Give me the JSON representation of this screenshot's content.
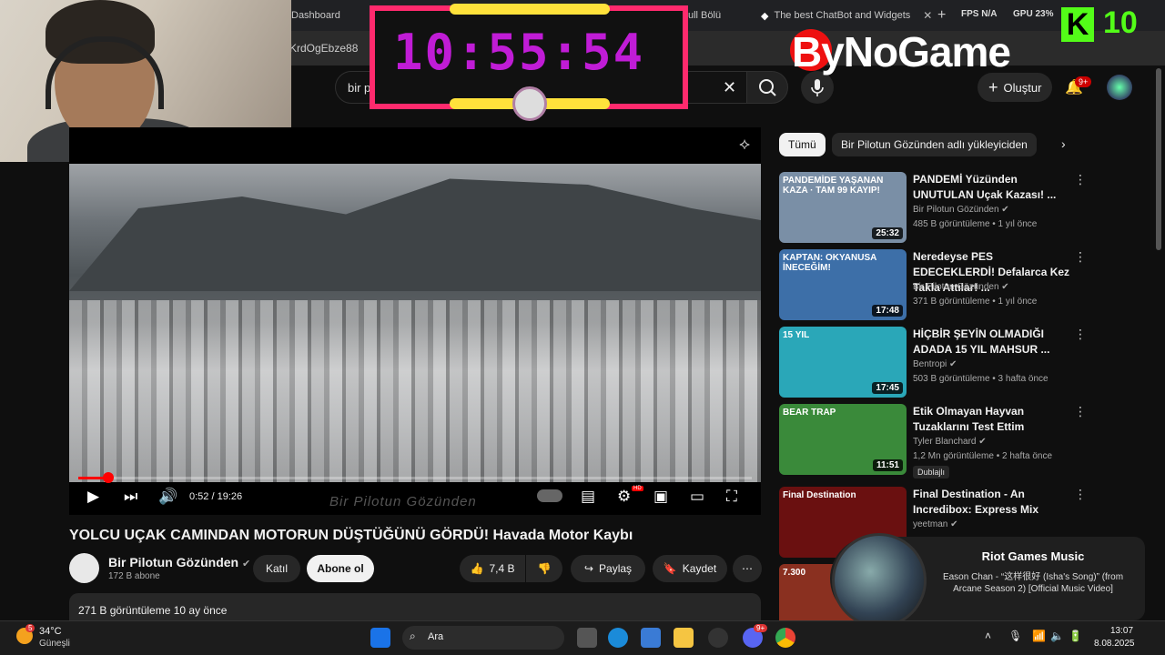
{
  "browser": {
    "tabs": [
      {
        "label": "Dashboard"
      },
      {
        "label": "The best ChatBot and Widgets"
      },
      {
        "label": "ull Bölü"
      }
    ],
    "new_tab": "+",
    "url_fragment": "KrdOgEbze88"
  },
  "hud": {
    "fps_label": "FPS",
    "fps_value": "N/A",
    "gpu_label": "GPU",
    "gpu_value": "23%"
  },
  "overlay": {
    "clock": "10:55:54",
    "brand": "ByNoGame",
    "kick_letter": "K",
    "kick_count": "10"
  },
  "header": {
    "search_value": "bir pilotun gözünden",
    "create_label": "Oluştur",
    "notif_count": "9+"
  },
  "player": {
    "time": "0:52 / 19:26",
    "watermark": "Bir Pilotun Gözünden",
    "hd": "HD",
    "progress": 0.045
  },
  "video": {
    "title": "YOLCU UÇAK CAMINDAN MOTORUN DÜŞTÜĞÜNÜ GÖRDÜ! Havada Motor Kaybı",
    "channel": "Bir Pilotun Gözünden",
    "subs": "172 B abone",
    "join": "Katıl",
    "subscribe": "Abone ol",
    "likes": "7,4 B",
    "share": "Paylaş",
    "save": "Kaydet",
    "desc": "271 B görüntüleme  10 ay önce"
  },
  "sidebar": {
    "chips": [
      {
        "label": "Tümü"
      },
      {
        "label": "Bir Pilotun Gözünden adlı yükleyiciden"
      }
    ],
    "recs": [
      {
        "title": "PANDEMİ Yüzünden UNUTULAN Uçak Kazası! ...",
        "channel": "Bir Pilotun Gözünden",
        "meta": "485 B görüntüleme • 1 yıl önce",
        "duration": "25:32",
        "thumb_text": "PANDEMİDE YAŞANAN KAZA · TAM 99 KAYIP!",
        "color": "#7a8fa6"
      },
      {
        "title": "Neredeyse PES EDECEKLERDİ! Defalarca Kez Takla Attılar! ...",
        "channel": "Bir Pilotun Gözünden",
        "meta": "371 B görüntüleme • 1 yıl önce",
        "duration": "17:48",
        "thumb_text": "KAPTAN: OKYANUSA İNECEĞİM!",
        "color": "#3d6fa8"
      },
      {
        "title": "HİÇBİR ŞEYİN OLMADIĞI ADADA 15 YIL MAHSUR ...",
        "channel": "Bentropi",
        "meta": "503 B görüntüleme • 3 hafta önce",
        "duration": "17:45",
        "thumb_text": "15 YIL",
        "color": "#2aa7b8"
      },
      {
        "title": "Etik Olmayan Hayvan Tuzaklarını Test Ettim",
        "channel": "Tyler Blanchard",
        "meta": "1,2 Mn görüntüleme • 2 hafta önce",
        "duration": "11:51",
        "thumb_text": "BEAR TRAP",
        "color": "#3a8a3a",
        "badge": "Dublajlı"
      },
      {
        "title": "Final Destination - An Incredibox: Express Mix",
        "channel": "yeetman",
        "meta": "",
        "duration": "",
        "thumb_text": "Final Destination",
        "color": "#6a1010"
      },
      {
        "title": "",
        "channel": "",
        "meta": "",
        "duration": "",
        "thumb_text": "7.300",
        "color": "#8a3020"
      }
    ]
  },
  "music": {
    "title": "Riot Games Music",
    "subtitle": "Eason Chan - “这样很好 (Isha's Song)” (from Arcane Season 2) [Official Music Video]"
  },
  "taskbar": {
    "weather_temp": "34°C",
    "weather_desc": "Güneşli",
    "weather_badge": "5",
    "search_placeholder": "Ara",
    "time": "13:07",
    "date": "8.08.2025",
    "discord_badge": "9+"
  }
}
